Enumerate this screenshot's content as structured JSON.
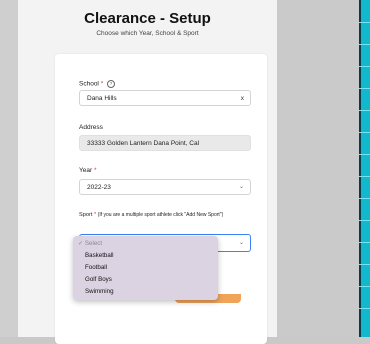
{
  "header": {
    "title": "Clearance - Setup",
    "subtitle": "Choose which Year, School & Sport"
  },
  "form": {
    "school": {
      "label": "School",
      "required": "*",
      "help_icon": "?",
      "value": "Dana Hills",
      "clear": "x"
    },
    "address": {
      "label": "Address",
      "value": "33333 Golden Lantern Dana Point, Cal"
    },
    "year": {
      "label": "Year",
      "required": "*",
      "value": "2022-23"
    },
    "sport": {
      "label": "Sport",
      "required": "*",
      "note": "(If you are a multiple sport athlete click \"Add New Sport\")",
      "options": [
        "Select",
        "Basketball",
        "Football",
        "Golf Boys",
        "Swimming"
      ],
      "selected_mark": "✓"
    }
  },
  "colors": {
    "focus": "#3b82f6",
    "dropdown_bg": "#dcd3e2",
    "submit_button": "#f0a45a",
    "required": "#e33333",
    "right_strip": "#12b8cc"
  },
  "icons": {
    "chevron": "chevron-down-icon",
    "clear": "clear-icon",
    "help": "help-icon",
    "check": "check-icon"
  }
}
